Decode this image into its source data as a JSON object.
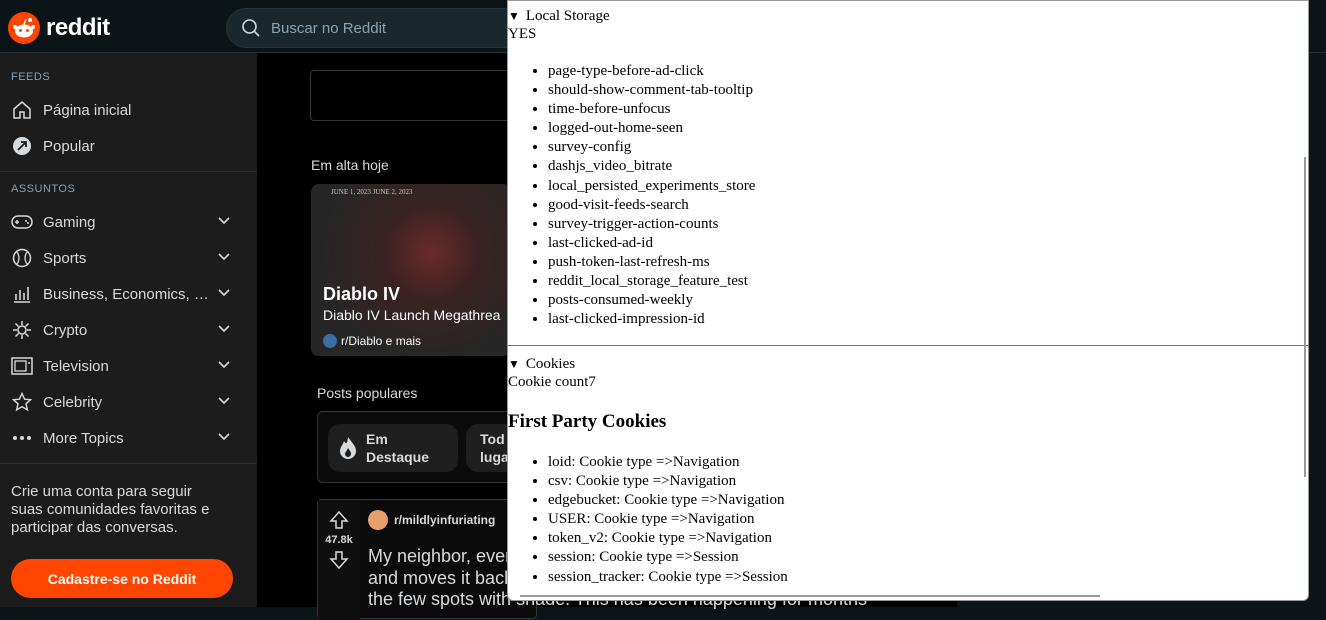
{
  "header": {
    "logo_text": "reddit",
    "search_placeholder": "Buscar no Reddit"
  },
  "sidebar": {
    "feeds_heading": "FEEDS",
    "feeds": [
      {
        "label": "Página inicial",
        "icon": "home-icon"
      },
      {
        "label": "Popular",
        "icon": "popular-icon"
      }
    ],
    "topics_heading": "ASSUNTOS",
    "topics": [
      {
        "label": "Gaming",
        "icon": "gamepad-icon"
      },
      {
        "label": "Sports",
        "icon": "ball-icon"
      },
      {
        "label": "Business, Economics, a...",
        "icon": "chart-icon"
      },
      {
        "label": "Crypto",
        "icon": "crypto-icon"
      },
      {
        "label": "Television",
        "icon": "tv-icon"
      },
      {
        "label": "Celebrity",
        "icon": "star-icon"
      },
      {
        "label": "More Topics",
        "icon": "more-icon"
      }
    ],
    "cta_text": "Crie uma conta para seguir suas comunidades favoritas e participar das conversas.",
    "cta_button": "Cadastre-se no Reddit"
  },
  "main": {
    "trending_title": "Em alta hoje",
    "trend_card": {
      "dates": "JUNE 1, 2023    JUNE 2, 2023",
      "title": "Diablo IV",
      "subtitle": "Diablo IV Launch Megathrea",
      "community": "r/Diablo e mais"
    },
    "popular_title": "Posts populares",
    "pills": [
      "Em Destaque",
      "Tod luga"
    ],
    "post": {
      "votes": "47.8k",
      "subreddit": "r/mildlyinfuriating",
      "title_line1": "My neighbor, ever",
      "title_line2": "and moves it back",
      "title_line3": "the few spots with shade. This has been happening for months"
    }
  },
  "panel": {
    "local_storage_label": "Local Storage",
    "local_storage_value": "YES",
    "local_storage_keys": [
      "page-type-before-ad-click",
      "should-show-comment-tab-tooltip",
      "time-before-unfocus",
      "logged-out-home-seen",
      "survey-config",
      "dashjs_video_bitrate",
      "local_persisted_experiments_store",
      "good-visit-feeds-search",
      "survey-trigger-action-counts",
      "last-clicked-ad-id",
      "push-token-last-refresh-ms",
      "reddit_local_storage_feature_test",
      "posts-consumed-weekly",
      "last-clicked-impression-id"
    ],
    "cookies_label": "Cookies",
    "cookie_count_text": "Cookie count7",
    "first_party_heading": "First Party Cookies",
    "cookies": [
      "loid: Cookie type =>Navigation",
      "csv: Cookie type =>Navigation",
      "edgebucket: Cookie type =>Navigation",
      "USER: Cookie type =>Navigation",
      "token_v2: Cookie type =>Navigation",
      "session: Cookie type =>Session",
      "session_tracker: Cookie type =>Session"
    ]
  },
  "colors": {
    "brand": "#ff4500",
    "sidebar_bg": "#1c1c1d",
    "main_bg": "#000000"
  }
}
